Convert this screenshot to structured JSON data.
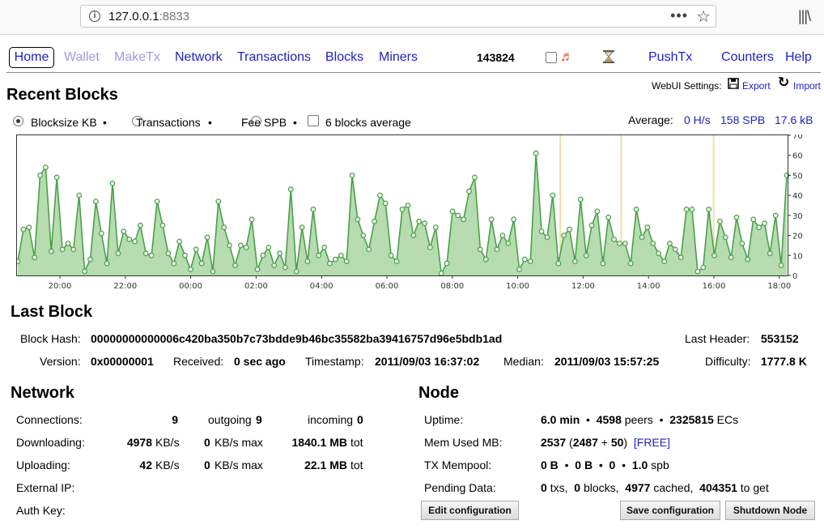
{
  "browser": {
    "host": "127.0.0.1",
    "port": ":8833"
  },
  "nav": {
    "home": "Home",
    "wallet": "Wallet",
    "maketx": "MakeTx",
    "network": "Network",
    "transactions": "Transactions",
    "blocks": "Blocks",
    "miners": "Miners",
    "height": "143824",
    "pushtx": "PushTx",
    "counters": "Counters",
    "help": "Help"
  },
  "settings": {
    "label": "WebUI Settings:",
    "export": "Export",
    "import": "Import"
  },
  "recent": {
    "title": "Recent Blocks",
    "opt_blocksize": "Blocksize KB",
    "opt_transactions": "Transactions",
    "opt_fee": "Fee SPB",
    "opt_avg": "6 blocks average",
    "sep": "•",
    "average_label": "Average:",
    "avg_hs": "0 H/s",
    "avg_spb": "158 SPB",
    "avg_kb": "17.6 kB"
  },
  "chart_data": {
    "type": "area",
    "series": [
      {
        "values": [
          7,
          23,
          24,
          9,
          50,
          54,
          12,
          49,
          13,
          16,
          13,
          40,
          2,
          8,
          37,
          21,
          6,
          46,
          11,
          22,
          18,
          17,
          25,
          11,
          10,
          37,
          25,
          11,
          6,
          17,
          10,
          3,
          13,
          6,
          19,
          2,
          37,
          24,
          15,
          5,
          15,
          14,
          28,
          3,
          10,
          14,
          5,
          11,
          4,
          43,
          2,
          24,
          7,
          33,
          10,
          14,
          6,
          8,
          10,
          7,
          50,
          28,
          20,
          13,
          27,
          40,
          36,
          10,
          7,
          33,
          35,
          20,
          27,
          26,
          14,
          24,
          1,
          6,
          32,
          30,
          28,
          42,
          49,
          13,
          8,
          28,
          13,
          20,
          16,
          28,
          3,
          8,
          7,
          61,
          22,
          19,
          40,
          6,
          20,
          23,
          7,
          38,
          10,
          25,
          32,
          6,
          29,
          18,
          16,
          16,
          6,
          33,
          19,
          24,
          16,
          11,
          7,
          16,
          13,
          9,
          33,
          33,
          2,
          4,
          33,
          10,
          27,
          19,
          9,
          29,
          16,
          8,
          28,
          24,
          26,
          11,
          30,
          5,
          50
        ]
      }
    ],
    "ylim": [
      0,
      70
    ],
    "yticks": [
      0,
      10,
      20,
      30,
      40,
      50,
      60,
      70
    ],
    "xticks": [
      "20:00",
      "22:00",
      "00:00",
      "02:00",
      "04:00",
      "06:00",
      "08:00",
      "10:00",
      "12:00",
      "14:00",
      "16:00",
      "18:00"
    ],
    "colors": {
      "line": "#4aa04a",
      "fill": "#b6dcb0",
      "marker_fill": "#eaf7ea",
      "highlight": "#e8e2a8"
    }
  },
  "last_block": {
    "title": "Last Block",
    "hash_label": "Block Hash:",
    "hash": "00000000000006c420ba350b7c73bdde9b46bc35582ba39416757d96e5bdb1ad",
    "last_header_label": "Last Header:",
    "last_header": "553152",
    "version_label": "Version:",
    "version": "0x00000001",
    "received_label": "Received:",
    "received": "0 sec ago",
    "timestamp_label": "Timestamp:",
    "timestamp": "2011/09/03 16:37:02",
    "median_label": "Median:",
    "median": "2011/09/03 15:57:25",
    "difficulty_label": "Difficulty:",
    "difficulty": "1777.8 K"
  },
  "network": {
    "title": "Network",
    "connections_label": "Connections:",
    "connections": "9",
    "outgoing_label": "outgoing",
    "outgoing": "9",
    "incoming_label": "incoming",
    "incoming": "0",
    "downloading_label": "Downloading:",
    "down_rate": "4978",
    "down_unit": "KB/s",
    "down_max": "0",
    "down_max_unit": "KB/s max",
    "down_total": "1840.1 MB",
    "down_total_unit": "tot",
    "uploading_label": "Uploading:",
    "up_rate": "42",
    "up_unit": "KB/s",
    "up_max": "0",
    "up_max_unit": "KB/s max",
    "up_total": "22.1 MB",
    "up_total_unit": "tot",
    "external_ip_label": "External IP:",
    "auth_key_label": "Auth Key:",
    "edit_config": "Edit configuration"
  },
  "node": {
    "title": "Node",
    "uptime_label": "Uptime:",
    "uptime": "6.0 min",
    "peers": "4598",
    "peers_unit": "peers",
    "ecs": "2325815",
    "ecs_unit": "ECs",
    "mem_label": "Mem Used MB:",
    "mem": "2537",
    "mem_detail_open": "(",
    "mem_a": "2487",
    "mem_plus": "+",
    "mem_b": "50",
    "mem_detail_close": ")",
    "mem_free": "[FREE]",
    "mempool_label": "TX Mempool:",
    "mp_a": "0 B",
    "mp_b": "0 B",
    "mp_c": "0",
    "mp_d": "1.0",
    "mp_unit": "spb",
    "pending_label": "Pending Data:",
    "pend_txs": "0",
    "pend_txs_unit": "txs,",
    "pend_blocks": "0",
    "pend_blocks_unit": "blocks,",
    "pend_cached": "4977",
    "pend_cached_unit": "cached,",
    "pend_get": "404351",
    "pend_get_unit": "to get",
    "save_config": "Save configuration",
    "shutdown": "Shutdown Node",
    "sep": "•"
  }
}
